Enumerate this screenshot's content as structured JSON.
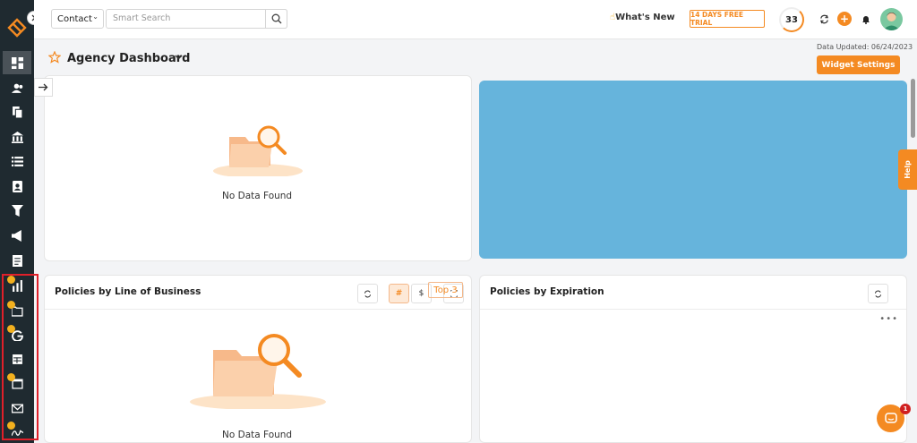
{
  "topbar": {
    "contact_label": "Contact",
    "search_placeholder": "Smart Search",
    "whats_new": "What's New",
    "trial_label": "14 DAYS FREE TRIAL",
    "counter_value": "33",
    "plus_label": "+"
  },
  "header": {
    "title": "Agency Dashboard",
    "data_updated": "Data Updated: 06/24/2023",
    "widget_settings": "Widget Settings"
  },
  "cards": {
    "top_left": {
      "empty_text": "No Data Found"
    },
    "policies_lob": {
      "title": "Policies by Line of Business",
      "hash_label": "#",
      "dollar_label": "$",
      "top_label": "Top 3",
      "empty_text": "No Data Found"
    },
    "policies_exp": {
      "title": "Policies by Expiration",
      "more_label": "•••"
    }
  },
  "help": {
    "label": "Help"
  },
  "chat": {
    "badge": "1"
  },
  "colors": {
    "accent": "#f48a22",
    "sidebar": "#1f2a30",
    "blue_card": "#66b4dc",
    "highlight": "#e0202a"
  },
  "sidebar_icons": [
    "dashboard-icon",
    "contacts-icon",
    "documents-icon",
    "bank-icon",
    "list-icon",
    "contact-card-icon",
    "funnel-icon",
    "megaphone-icon",
    "notes-icon",
    "chart-icon",
    "folder-icon",
    "google-icon",
    "table-icon",
    "calendar-icon",
    "mail-icon",
    "signature-icon"
  ]
}
